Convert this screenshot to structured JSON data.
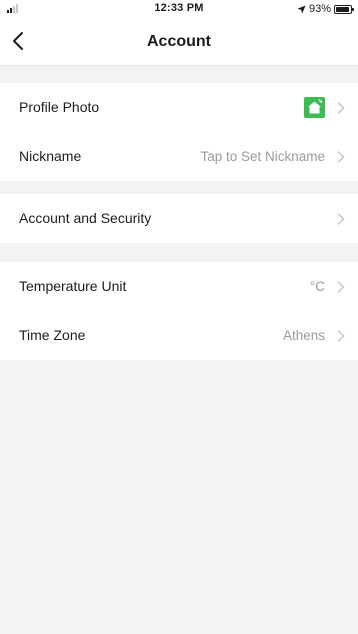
{
  "status_bar": {
    "time": "12:33 PM",
    "battery": "93%",
    "icons": [
      "signal-icon",
      "location-arrow-icon",
      "battery-icon"
    ]
  },
  "nav": {
    "title": "Account",
    "back_icon": "chevron-left-icon"
  },
  "groups": [
    {
      "rows": [
        {
          "label": "Profile Photo",
          "avatar_icon": "home-avatar-icon",
          "avatar_color": "#3dbb53"
        },
        {
          "label": "Nickname",
          "value": "Tap to Set Nickname"
        }
      ]
    },
    {
      "rows": [
        {
          "label": "Account and Security"
        }
      ]
    },
    {
      "rows": [
        {
          "label": "Temperature Unit",
          "value": "°C"
        },
        {
          "label": "Time Zone",
          "value": "Athens"
        }
      ]
    }
  ],
  "colors": {
    "background": "#f3f3f5",
    "surface": "#ffffff",
    "text": "#1c1c1e",
    "secondary_text": "#9a9aa0",
    "accent": "#3dbb53"
  }
}
